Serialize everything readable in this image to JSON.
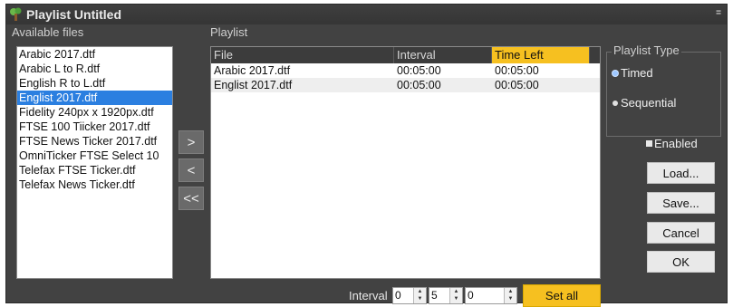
{
  "window": {
    "title": "Playlist Untitled",
    "title_button": "="
  },
  "available": {
    "label": "Available files",
    "items": [
      "Arabic 2017.dtf",
      "Arabic L to R.dtf",
      "English R to L.dtf",
      "Englist 2017.dtf",
      "Fidelity 240px x 1920px.dtf",
      "FTSE 100 Tiicker 2017.dtf",
      "FTSE News Ticker 2017.dtf",
      "OmniTicker FTSE Select 10",
      "Telefax FTSE Ticker.dtf",
      "Telefax News Ticker.dtf"
    ],
    "selected_index": 3
  },
  "move_buttons": {
    "add": ">",
    "remove": "<",
    "remove_all": "<<"
  },
  "playlist": {
    "label": "Playlist",
    "columns": [
      "File",
      "Interval",
      "Time Left"
    ],
    "active_column": 2,
    "rows": [
      [
        "Arabic 2017.dtf",
        "00:05:00",
        "00:05:00"
      ],
      [
        "Englist 2017.dtf",
        "00:05:00",
        "00:05:00"
      ]
    ]
  },
  "playlist_type": {
    "label": "Playlist Type",
    "options": [
      "Timed",
      "Sequential"
    ],
    "selected": "Timed"
  },
  "enabled": {
    "label": "Enabled"
  },
  "buttons": {
    "load": "Load...",
    "save": "Save...",
    "cancel": "Cancel",
    "ok": "OK"
  },
  "interval": {
    "label": "Interval",
    "hours": "0",
    "minutes": "5",
    "seconds": "0",
    "set_all": "Set all"
  },
  "colors": {
    "accent": "#f6c020",
    "selection": "#2b7fe0",
    "window_bg": "#424242"
  }
}
